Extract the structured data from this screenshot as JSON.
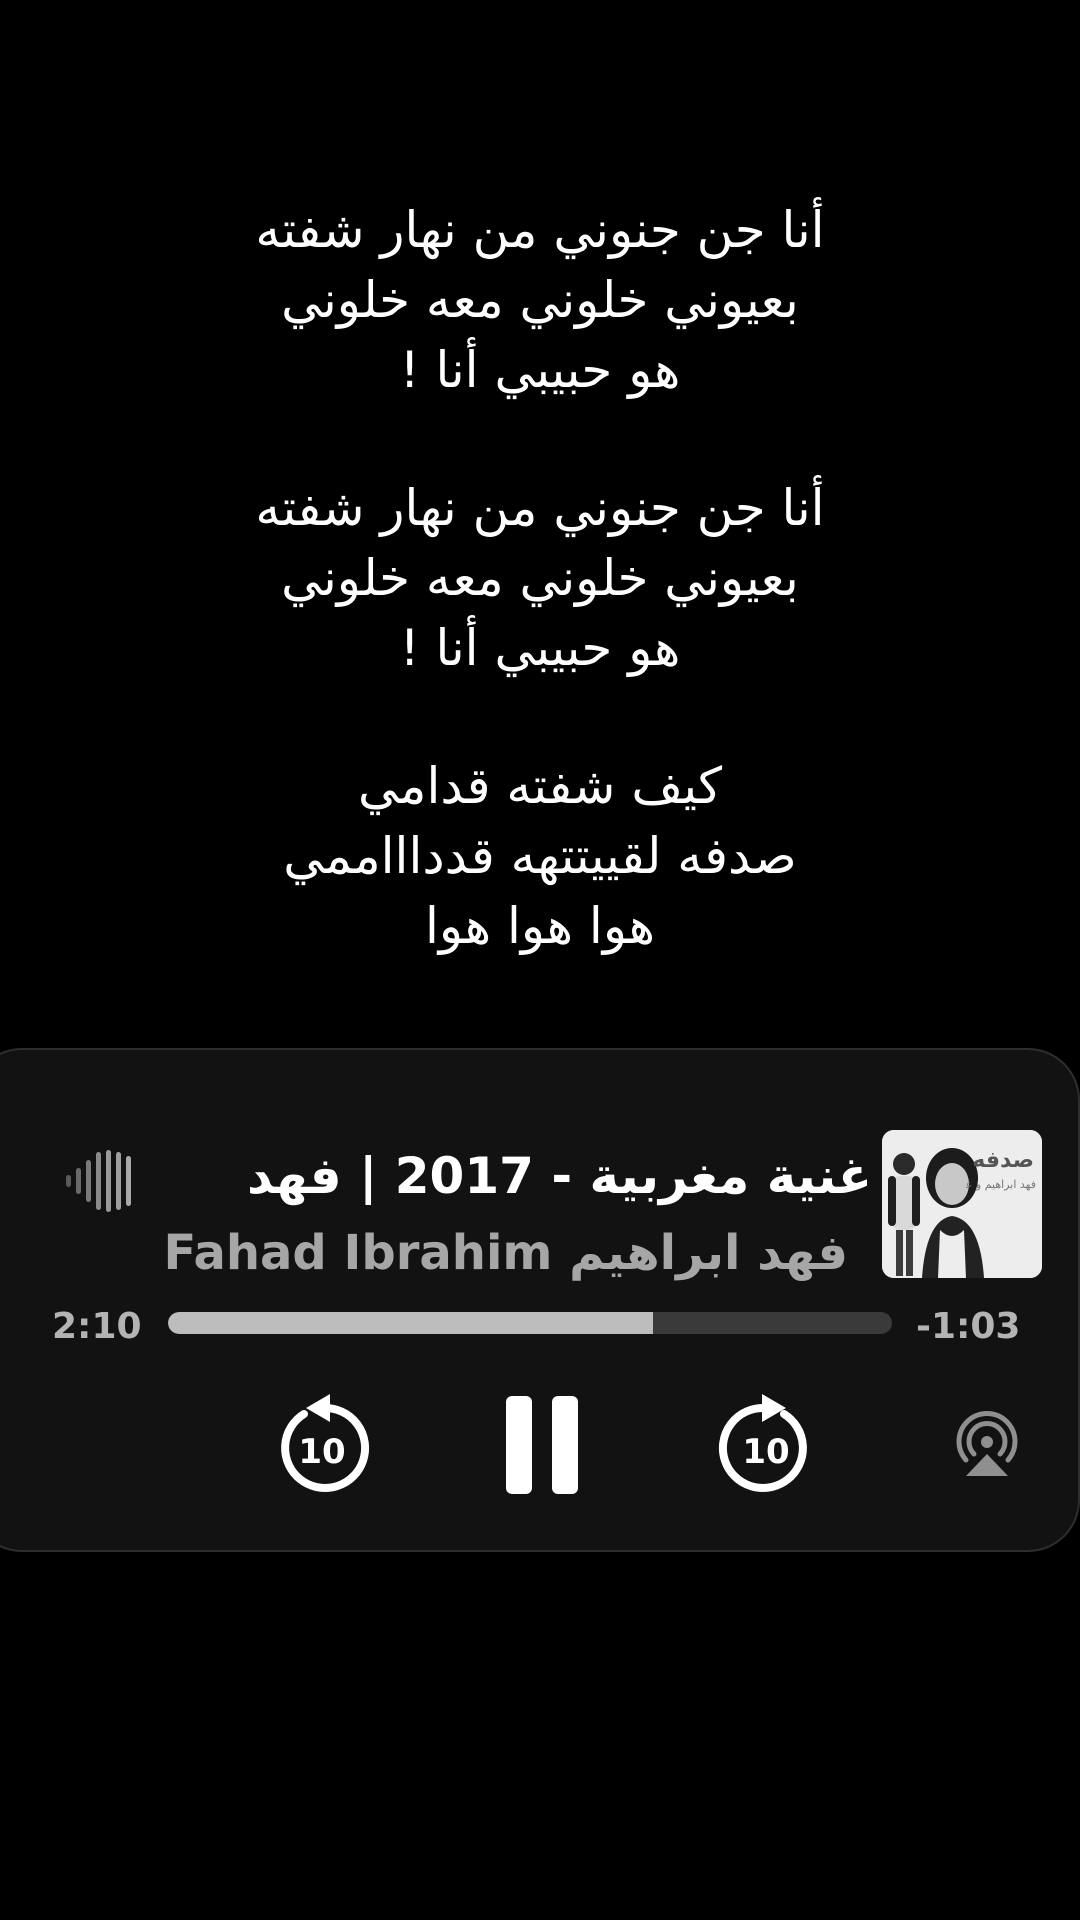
{
  "lyrics": {
    "stanzas": [
      [
        "أنا جن جنوني من نهار شفته",
        "بعيوني خلوني معه خلوني",
        "هو حبيبي أنا !"
      ],
      [
        "أنا جن جنوني من نهار شفته",
        "بعيوني خلوني معه خلوني",
        "هو حبيبي أنا !"
      ],
      [
        "كيف شفته قدامي",
        "صدفه لقييتتهه قدداااممي",
        "هوا هوا هوا"
      ]
    ]
  },
  "player": {
    "title": "غنية مغربية - 2017 | فهد",
    "artist": "فهد ابراهيم Fahad Ibrahim",
    "time_elapsed": "2:10",
    "time_remaining": "-1:03",
    "progress_percent": 67,
    "skip_back_seconds": "10",
    "skip_forward_seconds": "10",
    "album_art_text": "صدفه",
    "album_art_subtext": "فهد ابراهيم و عنود"
  },
  "colors": {
    "background": "#000000",
    "card": "#121212",
    "progress_fill": "#bdbdbd",
    "progress_track": "#3a3a3a",
    "secondary_text": "#a6a6a6"
  },
  "icons": {
    "waveform": "waveform-icon",
    "skip_back": "skip-back-10-icon",
    "pause": "pause-icon",
    "skip_forward": "skip-forward-10-icon",
    "airplay": "airplay-audio-icon"
  }
}
